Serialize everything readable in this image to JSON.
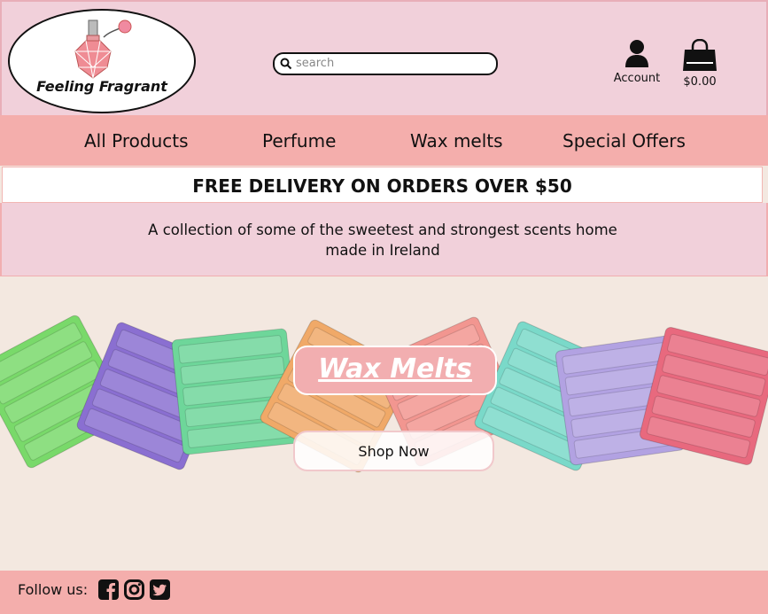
{
  "header": {
    "logo_text": "Feeling Fragrant",
    "search": {
      "placeholder": "search",
      "value": ""
    },
    "account_label": "Account",
    "cart_total": "$0.00"
  },
  "nav": {
    "items": [
      {
        "label": "All Products"
      },
      {
        "label": "Perfume"
      },
      {
        "label": "Wax melts"
      },
      {
        "label": "Special Offers"
      }
    ]
  },
  "banner": {
    "text": "FREE DELIVERY ON ORDERS OVER $50"
  },
  "tagline": {
    "text": "A collection of some of the sweetest and strongest scents home made in Ireland"
  },
  "hero": {
    "title": "Wax Melts",
    "button_label": "Shop Now",
    "melt_colors": [
      "#79d96a",
      "#8a6fd1",
      "#6ed69a",
      "#f0a968",
      "#f29690",
      "#7ad9c9",
      "#b2a2e2",
      "#e8697e"
    ]
  },
  "footer": {
    "follow_label": "Follow us:",
    "social_icons": [
      "facebook-icon",
      "instagram-icon",
      "twitter-icon"
    ]
  },
  "colors": {
    "header_bg": "#f1d0da",
    "nav_bg": "#f4aeac",
    "hero_bg": "#f3e8e0",
    "title_bg": "#f2aeb0"
  }
}
